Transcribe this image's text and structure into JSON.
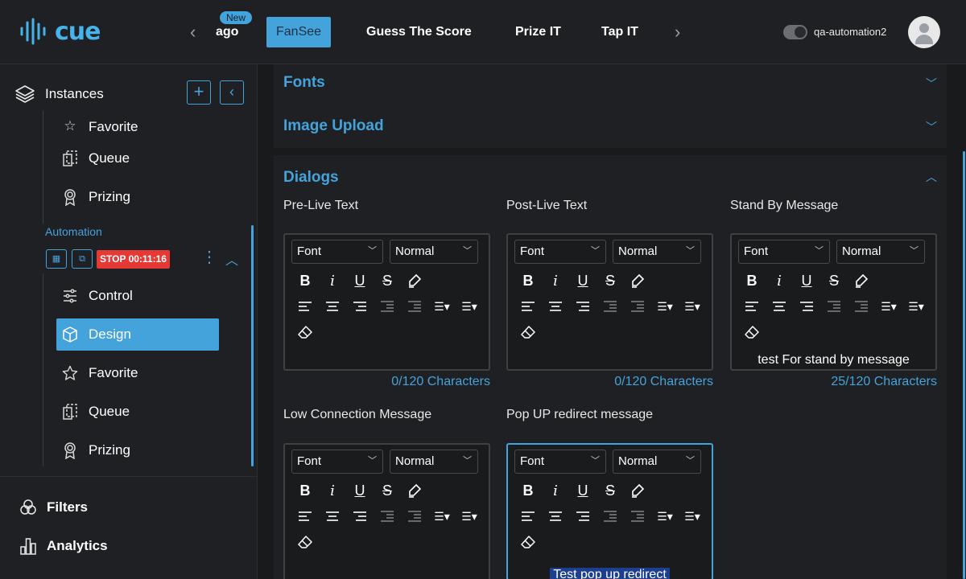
{
  "app": {
    "logo_text": "cue",
    "nav": {
      "new_badge": "New",
      "tabs": [
        {
          "label": "ago"
        },
        {
          "label": "FanSee"
        },
        {
          "label": "Guess The Score"
        },
        {
          "label": "Prize IT"
        },
        {
          "label": "Tap IT"
        }
      ]
    },
    "username": "qa-automation2"
  },
  "sidebar": {
    "title": "Instances",
    "top_items": [
      {
        "label": "Favorite",
        "icon": "star-icon"
      },
      {
        "label": "Queue",
        "icon": "queue-icon"
      },
      {
        "label": "Prizing",
        "icon": "award-icon"
      }
    ],
    "automation": {
      "label": "Automation",
      "stop_badge": "STOP 00:11:16"
    },
    "automation_items": [
      {
        "label": "Control",
        "icon": "sliders-icon"
      },
      {
        "label": "Design",
        "icon": "cube-icon",
        "active": true
      },
      {
        "label": "Favorite",
        "icon": "star-icon"
      },
      {
        "label": "Queue",
        "icon": "queue-icon"
      },
      {
        "label": "Prizing",
        "icon": "award-icon"
      }
    ],
    "bottom_items": [
      {
        "label": "Filters",
        "icon": "filters-icon"
      },
      {
        "label": "Analytics",
        "icon": "analytics-icon"
      }
    ]
  },
  "main": {
    "sections": [
      {
        "title": "Fonts",
        "expanded": false
      },
      {
        "title": "Image Upload",
        "expanded": false
      },
      {
        "title": "Dialogs",
        "expanded": true
      }
    ],
    "editor_common": {
      "font_select": "Font",
      "size_select": "Normal"
    },
    "dialogs": [
      {
        "label": "Pre-Live Text",
        "text": "",
        "count": "0/120 Characters"
      },
      {
        "label": "Post-Live Text",
        "text": "",
        "count": "0/120 Characters"
      },
      {
        "label": "Stand By Message",
        "text": "test For stand by message",
        "count": "25/120 Characters"
      },
      {
        "label": "Low Connection Message",
        "text": "",
        "count": ""
      },
      {
        "label": "Pop UP redirect message",
        "text": "Test pop up redirect",
        "count": ""
      }
    ]
  },
  "colors": {
    "accent": "#45a3dc",
    "stop": "#e53935",
    "background": "#191a1c",
    "panel": "#1f2023"
  }
}
